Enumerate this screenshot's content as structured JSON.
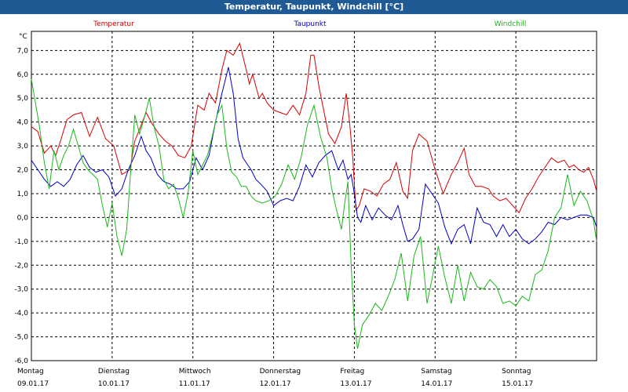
{
  "window": {
    "title": "Temperatur, Taupunkt, Windchill [°C]"
  },
  "chart_data": {
    "type": "line",
    "title": "Temperatur, Taupunkt, Windchill [°C]",
    "ylabel": "°C",
    "xlabel": "",
    "ylim": [
      -6.0,
      7.8
    ],
    "y_ticks": [
      "7,0",
      "6,0",
      "5,0",
      "4,0",
      "3,0",
      "2,0",
      "1,0",
      "0,0",
      "-1,0",
      "-2,0",
      "-3,0",
      "-4,0",
      "-5,0",
      "-6,0"
    ],
    "xlim": [
      0,
      7
    ],
    "x_ticks": [
      {
        "day": "Montag",
        "date": "09.01.17"
      },
      {
        "day": "Dienstag",
        "date": "10.01.17"
      },
      {
        "day": "Mittwoch",
        "date": "11.01.17"
      },
      {
        "day": "Donnerstag",
        "date": "12.01.17"
      },
      {
        "day": "Freitag",
        "date": "13.01.17"
      },
      {
        "day": "Samstag",
        "date": "14.01.17"
      },
      {
        "day": "Sonntag",
        "date": "15.01.17"
      }
    ],
    "grid": true,
    "legend_placement": "top",
    "series": [
      {
        "name": "Temperatur",
        "color": "#d80000",
        "x": [
          0,
          0.08,
          0.16,
          0.24,
          0.3,
          0.36,
          0.44,
          0.52,
          0.62,
          0.72,
          0.82,
          0.92,
          1.02,
          1.12,
          1.22,
          1.28,
          1.34,
          1.42,
          1.5,
          1.58,
          1.66,
          1.74,
          1.82,
          1.9,
          1.98,
          2.06,
          2.14,
          2.2,
          2.28,
          2.36,
          2.42,
          2.5,
          2.58,
          2.66,
          2.7,
          2.74,
          2.78,
          2.82,
          2.86,
          2.92,
          3.0,
          3.08,
          3.16,
          3.24,
          3.32,
          3.4,
          3.46,
          3.5,
          3.56,
          3.62,
          3.68,
          3.76,
          3.84,
          3.9,
          3.94,
          3.98,
          4.02,
          4.06,
          4.12,
          4.2,
          4.28,
          4.36,
          4.44,
          4.52,
          4.6,
          4.66,
          4.72,
          4.8,
          4.9,
          5.0,
          5.1,
          5.2,
          5.28,
          5.36,
          5.42,
          5.5,
          5.58,
          5.66,
          5.72,
          5.8,
          5.88,
          5.96,
          6.04,
          6.12,
          6.2,
          6.28,
          6.36,
          6.44,
          6.52,
          6.6,
          6.66,
          6.72,
          6.78,
          6.84,
          6.9,
          6.96,
          7.0
        ],
        "y": [
          3.8,
          3.6,
          2.7,
          3.0,
          2.6,
          3.2,
          4.1,
          4.3,
          4.4,
          3.4,
          4.2,
          3.3,
          3.0,
          1.8,
          2.0,
          3.2,
          3.7,
          4.4,
          3.9,
          3.5,
          3.2,
          3.0,
          2.6,
          2.5,
          3.0,
          4.7,
          4.5,
          5.2,
          4.8,
          6.2,
          7.0,
          6.8,
          7.3,
          6.2,
          5.6,
          6.0,
          5.5,
          5.0,
          5.2,
          4.8,
          4.5,
          4.4,
          4.3,
          4.7,
          4.3,
          5.2,
          6.8,
          6.8,
          5.5,
          4.5,
          3.5,
          3.1,
          3.8,
          5.2,
          4.0,
          2.5,
          0.3,
          0.5,
          1.2,
          1.1,
          0.9,
          1.4,
          1.6,
          2.3,
          1.1,
          0.8,
          2.8,
          3.5,
          3.2,
          2.0,
          1.0,
          1.8,
          2.3,
          2.9,
          1.8,
          1.3,
          1.3,
          1.2,
          0.9,
          0.7,
          0.8,
          0.5,
          0.2,
          0.8,
          1.2,
          1.7,
          2.1,
          2.5,
          2.3,
          2.4,
          2.1,
          2.2,
          2.0,
          1.9,
          2.1,
          1.6,
          1.1
        ]
      },
      {
        "name": "Taupunkt",
        "color": "#0000c8",
        "x": [
          0,
          0.08,
          0.16,
          0.24,
          0.32,
          0.4,
          0.48,
          0.56,
          0.64,
          0.72,
          0.8,
          0.88,
          0.96,
          1.04,
          1.12,
          1.2,
          1.28,
          1.36,
          1.42,
          1.48,
          1.56,
          1.64,
          1.72,
          1.8,
          1.88,
          1.96,
          2.04,
          2.12,
          2.2,
          2.28,
          2.36,
          2.44,
          2.5,
          2.56,
          2.62,
          2.66,
          2.72,
          2.78,
          2.84,
          2.92,
          3.0,
          3.08,
          3.16,
          3.24,
          3.32,
          3.4,
          3.48,
          3.56,
          3.64,
          3.72,
          3.8,
          3.86,
          3.92,
          3.96,
          4.0,
          4.04,
          4.08,
          4.14,
          4.22,
          4.3,
          4.38,
          4.46,
          4.54,
          4.6,
          4.66,
          4.72,
          4.8,
          4.88,
          4.96,
          5.04,
          5.12,
          5.2,
          5.28,
          5.36,
          5.44,
          5.52,
          5.6,
          5.68,
          5.76,
          5.84,
          5.92,
          6.0,
          6.08,
          6.16,
          6.24,
          6.32,
          6.4,
          6.48,
          6.56,
          6.64,
          6.72,
          6.8,
          6.88,
          6.96,
          7.0
        ],
        "y": [
          2.4,
          2.0,
          1.6,
          1.3,
          1.5,
          1.3,
          1.6,
          2.2,
          2.6,
          2.1,
          1.9,
          2.0,
          1.7,
          0.9,
          1.2,
          2.0,
          2.6,
          3.4,
          2.8,
          2.5,
          1.8,
          1.5,
          1.4,
          1.2,
          1.2,
          1.5,
          2.5,
          2.0,
          2.6,
          4.0,
          5.2,
          6.3,
          5.2,
          3.3,
          2.5,
          2.3,
          2.0,
          1.6,
          1.4,
          1.1,
          0.5,
          0.7,
          0.8,
          0.7,
          1.3,
          2.2,
          1.7,
          2.3,
          2.6,
          2.8,
          2.0,
          2.4,
          1.6,
          1.8,
          1.0,
          0.0,
          -0.2,
          0.5,
          -0.1,
          0.4,
          0.1,
          -0.1,
          0.5,
          -0.3,
          -1.0,
          -0.9,
          -0.5,
          1.4,
          1.0,
          0.6,
          -0.4,
          -1.1,
          -0.5,
          -0.3,
          -1.1,
          0.4,
          -0.2,
          -0.3,
          -0.8,
          -0.3,
          -0.8,
          -0.5,
          -0.9,
          -1.1,
          -0.9,
          -0.6,
          -0.2,
          -0.3,
          0.0,
          -0.1,
          0.0,
          0.1,
          0.1,
          0.0,
          -0.4
        ]
      },
      {
        "name": "Windchill",
        "color": "#1ab81a",
        "x": [
          0,
          0.04,
          0.1,
          0.16,
          0.22,
          0.28,
          0.34,
          0.4,
          0.46,
          0.52,
          0.58,
          0.64,
          0.7,
          0.76,
          0.82,
          0.88,
          0.94,
          1.0,
          1.06,
          1.12,
          1.18,
          1.22,
          1.28,
          1.34,
          1.4,
          1.46,
          1.52,
          1.58,
          1.64,
          1.7,
          1.76,
          1.82,
          1.88,
          1.94,
          2.0,
          2.06,
          2.12,
          2.18,
          2.24,
          2.3,
          2.36,
          2.42,
          2.48,
          2.54,
          2.6,
          2.66,
          2.72,
          2.78,
          2.86,
          2.94,
          3.02,
          3.1,
          3.18,
          3.26,
          3.34,
          3.42,
          3.5,
          3.58,
          3.66,
          3.72,
          3.78,
          3.84,
          3.88,
          3.92,
          3.96,
          4.0,
          4.04,
          4.1,
          4.18,
          4.26,
          4.34,
          4.42,
          4.5,
          4.58,
          4.66,
          4.74,
          4.82,
          4.9,
          4.96,
          5.04,
          5.12,
          5.2,
          5.28,
          5.36,
          5.44,
          5.52,
          5.6,
          5.68,
          5.76,
          5.84,
          5.92,
          6.0,
          6.08,
          6.16,
          6.24,
          6.32,
          6.4,
          6.48,
          6.56,
          6.64,
          6.72,
          6.8,
          6.88,
          6.96,
          7.0
        ],
        "y": [
          5.8,
          5.0,
          3.8,
          2.3,
          1.2,
          2.8,
          2.0,
          2.6,
          3.0,
          3.7,
          3.0,
          2.3,
          2.0,
          1.8,
          1.6,
          0.5,
          -0.4,
          0.6,
          -0.8,
          -1.6,
          -0.5,
          1.5,
          4.3,
          3.5,
          4.2,
          5.0,
          3.8,
          3.0,
          1.6,
          1.2,
          1.4,
          0.8,
          0.0,
          1.0,
          2.8,
          1.8,
          2.2,
          2.6,
          3.4,
          4.3,
          4.7,
          2.9,
          1.9,
          1.7,
          1.3,
          1.3,
          0.9,
          0.7,
          0.6,
          0.7,
          0.9,
          1.4,
          2.2,
          1.6,
          2.5,
          3.9,
          4.7,
          3.4,
          2.5,
          1.2,
          0.3,
          -0.5,
          0.6,
          1.5,
          -2.0,
          -4.5,
          -5.5,
          -4.5,
          -4.1,
          -3.6,
          -3.9,
          -3.3,
          -2.6,
          -1.5,
          -3.5,
          -1.6,
          -0.8,
          -3.6,
          -2.6,
          -1.2,
          -2.5,
          -3.6,
          -2.0,
          -3.5,
          -2.3,
          -2.9,
          -3.0,
          -2.6,
          -2.9,
          -3.6,
          -3.5,
          -3.7,
          -3.3,
          -3.5,
          -2.4,
          -2.2,
          -1.4,
          0.0,
          0.4,
          1.8,
          0.5,
          1.1,
          0.7,
          -0.1,
          -1.0
        ]
      }
    ]
  }
}
